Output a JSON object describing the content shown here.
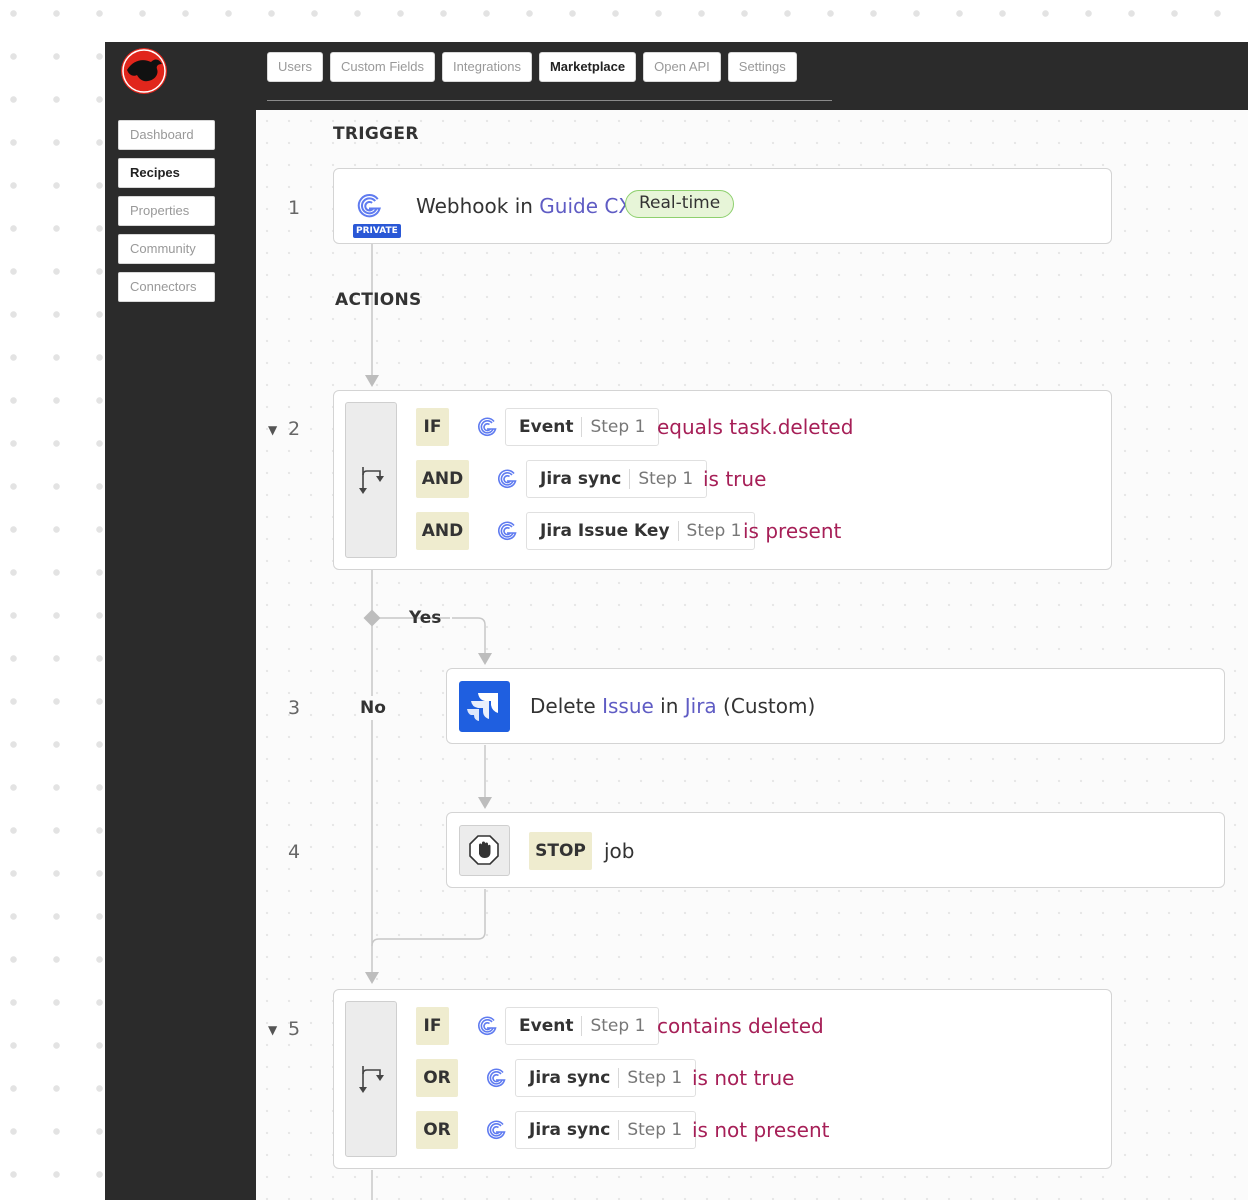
{
  "top_nav": [
    "Users",
    "Custom Fields",
    "Integrations",
    "Marketplace",
    "Open API",
    "Settings"
  ],
  "top_nav_active": "Marketplace",
  "side_nav": [
    "Dashboard",
    "Recipes",
    "Properties",
    "Community",
    "Connectors"
  ],
  "side_nav_active": "Recipes",
  "recipe": {
    "trigger_title": "TRIGGER",
    "actions_title": "ACTIONS",
    "step1": {
      "num": "1",
      "private_badge": "PRIVATE",
      "text_a": "Webhook in ",
      "app": "Guide CX",
      "realtime": "Real-time"
    },
    "step2": {
      "num": "2",
      "rows": [
        {
          "kw": "IF",
          "field": "Event",
          "step": "Step 1",
          "cond": "equals task.deleted"
        },
        {
          "kw": "AND",
          "field": "Jira sync",
          "step": "Step 1",
          "cond": "is true"
        },
        {
          "kw": "AND",
          "field": "Jira Issue Key",
          "step": "Step 1",
          "cond": "is present"
        }
      ]
    },
    "yes_label": "Yes",
    "no_label": "No",
    "step3": {
      "num": "3",
      "verb": "Delete ",
      "object": "Issue",
      "mid": " in ",
      "app": "Jira",
      "suffix": " (Custom)"
    },
    "step4": {
      "num": "4",
      "kw": "STOP",
      "text": "job"
    },
    "step5": {
      "num": "5",
      "rows": [
        {
          "kw": "IF",
          "field": "Event",
          "step": "Step 1",
          "cond": "contains deleted"
        },
        {
          "kw": "OR",
          "field": "Jira sync",
          "step": "Step 1",
          "cond": "is not true"
        },
        {
          "kw": "OR",
          "field": "Jira sync",
          "step": "Step 1",
          "cond": "is not present"
        }
      ]
    }
  },
  "colors": {
    "accent_blue": "#5f5cc4",
    "condition_red": "#a61f57",
    "realtime_green": "#8ed06e",
    "jira_blue": "#1f5fe0"
  }
}
